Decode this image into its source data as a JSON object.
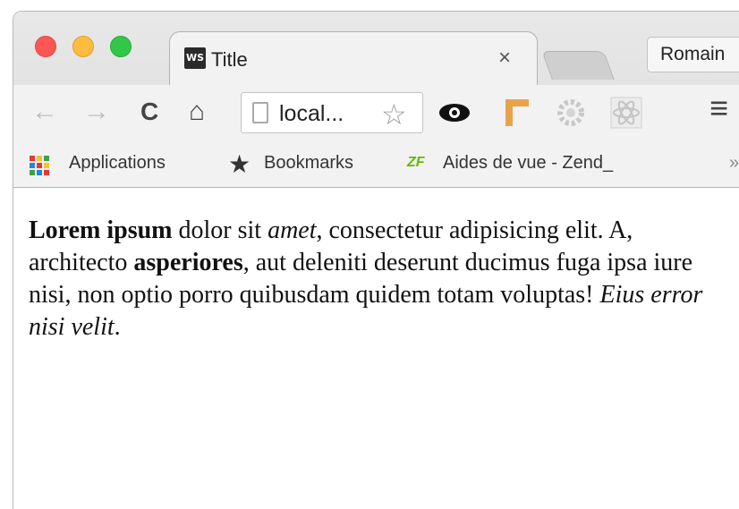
{
  "tab": {
    "favicon_text": "WS",
    "title": "Title",
    "close": "×"
  },
  "profile": {
    "name": "Romain"
  },
  "toolbar": {
    "back": "←",
    "forward": "→",
    "reload": "C",
    "home": "⌂",
    "url": "local...",
    "star": "☆",
    "menu": "≡"
  },
  "extensions": [
    "eye-icon",
    "orange-ruler-icon",
    "gear-extension-icon",
    "react-extension-icon"
  ],
  "bookmarks": {
    "apps_label": "Applications",
    "bookmarks_label": "Bookmarks",
    "zend_icon": "ZF",
    "zend_label": "Aides de vue - Zend_",
    "overflow": "»"
  },
  "content": {
    "p1_bold": "Lorem ipsum",
    "p1_text1": " dolor sit ",
    "p1_italic": "amet",
    "p1_text2": ", consectetur adipisicing elit. A, architecto ",
    "p1_bold2": "asperiores",
    "p1_text3": ", aut deleniti deserunt ducimus fuga ipsa iure nisi, non optio porro quibusdam quidem totam voluptas! ",
    "p1_italic2": "Eius error nisi velit",
    "p1_text4": "."
  },
  "colors": {
    "close": "#fc5753",
    "minimize": "#fdbc40",
    "zoom": "#33c748",
    "apps_grid": [
      "#e53935",
      "#fbc02d",
      "#43a047",
      "#1e88e5",
      "#e53935",
      "#fbc02d",
      "#43a047",
      "#1e88e5",
      "#e53935"
    ]
  }
}
